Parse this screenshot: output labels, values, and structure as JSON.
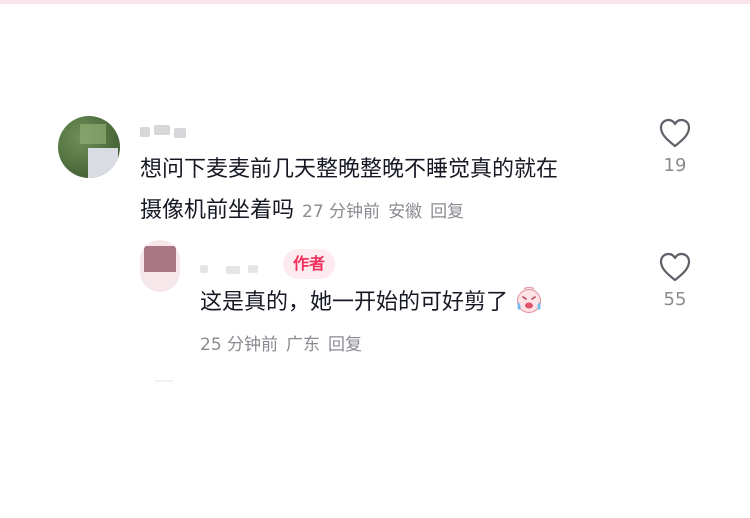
{
  "main_comment": {
    "text_line1": "想问下麦麦前几天整晚整晚不睡觉真的就在",
    "text_line2": "摄像机前坐着吗",
    "time": "27 分钟前",
    "location": "安徽",
    "reply_label": "回复",
    "likes": "19"
  },
  "reply_comment": {
    "author_badge": "作者",
    "text": "这是真的，她一开始的可好剪了",
    "emoji": "crying-laughing-face",
    "time": "25 分钟前",
    "location": "广东",
    "reply_label": "回复",
    "likes": "55"
  },
  "colors": {
    "badge_text": "#f0305a",
    "badge_bg": "#fdebf0",
    "meta_text": "#8a8b91",
    "top_strip": "#fbe5ec"
  }
}
